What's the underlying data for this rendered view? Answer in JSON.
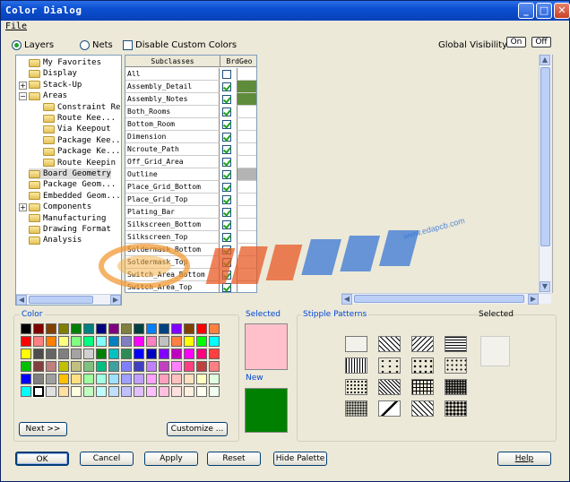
{
  "window": {
    "title": "Color Dialog",
    "minimize_glyph": "_",
    "maximize_glyph": "□",
    "close_glyph": "✕"
  },
  "menu": {
    "file": "File"
  },
  "options": {
    "layers_label": "Layers",
    "nets_label": "Nets",
    "disable_custom_colors_label": "Disable Custom Colors",
    "global_visibility_label": "Global Visibility:",
    "on_label": "On",
    "off_label": "Off",
    "mode": "Layers"
  },
  "tree": {
    "items": [
      {
        "label": "My Favorites",
        "level": 1
      },
      {
        "label": "Display",
        "level": 1
      },
      {
        "label": "Stack-Up",
        "level": 1,
        "expander": "+"
      },
      {
        "label": "Areas",
        "level": 1,
        "expander": "−",
        "open": true
      },
      {
        "label": "Constraint Re",
        "level": 2
      },
      {
        "label": "Route Kee...",
        "level": 2
      },
      {
        "label": "Via Keepout",
        "level": 2
      },
      {
        "label": "Package Kee..",
        "level": 2
      },
      {
        "label": "Package Ke...",
        "level": 2
      },
      {
        "label": "Route Keepin",
        "level": 2
      },
      {
        "label": "Board Geometry",
        "level": 1,
        "selected": true
      },
      {
        "label": "Package Geom...",
        "level": 1
      },
      {
        "label": "Embedded Geom...",
        "level": 1
      },
      {
        "label": "Components",
        "level": 1,
        "expander": "+"
      },
      {
        "label": "Manufacturing",
        "level": 1
      },
      {
        "label": "Drawing Format",
        "level": 1
      },
      {
        "label": "Analysis",
        "level": 1
      }
    ]
  },
  "grid": {
    "col_subclasses": "Subclasses",
    "col_brdgeo": "BrdGeo",
    "rows": [
      {
        "name": "All",
        "checked": false,
        "color": "#ffffff"
      },
      {
        "name": "Assembly_Detail",
        "checked": true,
        "color": "#5f8c3a"
      },
      {
        "name": "Assembly_Notes",
        "checked": true,
        "color": "#5f8c3a"
      },
      {
        "name": "Both_Rooms",
        "checked": true,
        "color": "#ffffff"
      },
      {
        "name": "Bottom_Room",
        "checked": true,
        "color": "#ffffff"
      },
      {
        "name": "Dimension",
        "checked": true,
        "color": "#ffffff"
      },
      {
        "name": "Ncroute_Path",
        "checked": true,
        "color": "#ffffff"
      },
      {
        "name": "Off_Grid_Area",
        "checked": true,
        "color": "#ffffff"
      },
      {
        "name": "Outline",
        "checked": true,
        "color": "#b4b4b4"
      },
      {
        "name": "Place_Grid_Bottom",
        "checked": true,
        "color": "#ffffff"
      },
      {
        "name": "Place_Grid_Top",
        "checked": true,
        "color": "#ffffff"
      },
      {
        "name": "Plating_Bar",
        "checked": true,
        "color": "#ffffff"
      },
      {
        "name": "Silkscreen_Bottom",
        "checked": true,
        "color": "#ffffff"
      },
      {
        "name": "Silkscreen_Top",
        "checked": true,
        "color": "#ffffff"
      },
      {
        "name": "Soldermask_Bottom",
        "checked": true,
        "color": "#ffffff"
      },
      {
        "name": "Soldermask_Top",
        "checked": true,
        "color": "#ffffff"
      },
      {
        "name": "Switch_Area_Bottom",
        "checked": true,
        "color": "#ffffff"
      },
      {
        "name": "Switch_Area_Top",
        "checked": true,
        "color": "#ffffff"
      }
    ]
  },
  "watermark": {
    "text": "eda pcb",
    "url": "www.edapcb.com"
  },
  "color_group": {
    "label": "Color",
    "swatches": [
      [
        "#000000",
        "#800000",
        "#804000",
        "#808000",
        "#008000",
        "#008080",
        "#000080",
        "#800080",
        "#808040",
        "#004040",
        "#0080ff",
        "#004080",
        "#8000ff",
        "#804000",
        "#ff0000",
        "#ff8040"
      ],
      [
        "#ff0000",
        "#ff8080",
        "#ff8000",
        "#ffff80",
        "#80ff80",
        "#00ff80",
        "#80ffff",
        "#0080c0",
        "#8080c0",
        "#ff00ff",
        "#ff80c0",
        "#c0c0c0",
        "#ff8040",
        "#ffff00",
        "#00ff00",
        "#00ffff"
      ],
      [
        "#ffff00",
        "#4d4d4d",
        "#666666",
        "#808080",
        "#a3a3a3",
        "#d0d0d0",
        "#008000",
        "#00c0c0",
        "#2e8b57",
        "#0000ff",
        "#0000c0",
        "#8000ff",
        "#c000c0",
        "#ff00ff",
        "#ff0080",
        "#ff4040"
      ],
      [
        "#00c000",
        "#804040",
        "#c08080",
        "#c0c000",
        "#c0c080",
        "#80c080",
        "#00c080",
        "#40a0a0",
        "#8080ff",
        "#4040c0",
        "#c080ff",
        "#c040c0",
        "#ff80ff",
        "#ff4080",
        "#c04040",
        "#ff8080"
      ],
      [
        "#0000ff",
        "#808080",
        "#a0a0a0",
        "#ffc000",
        "#ffe080",
        "#a0ffa0",
        "#a0ffe0",
        "#a0e0ff",
        "#a0a0ff",
        "#c0a0ff",
        "#ffa0ff",
        "#ffa0c0",
        "#ffc0c0",
        "#ffe0c0",
        "#ffffc0",
        "#e0ffe0"
      ],
      [
        "#00ffff",
        "#ffffff",
        "#e0e0e0",
        "#ffe0a0",
        "#ffffe0",
        "#c0ffc0",
        "#c0ffff",
        "#c0e0ff",
        "#c0c0ff",
        "#e0c0ff",
        "#ffc0ff",
        "#ffc0e0",
        "#ffe0e0",
        "#fff0e0",
        "#fffff0",
        "#f0fff0"
      ]
    ],
    "next_label": "Next >>",
    "customize_label": "Customize ..."
  },
  "selected_label": "Selected",
  "selected_color": "#ffc0cb",
  "new_label": "New",
  "new_color": "#008000",
  "stipple_group": {
    "label": "Stipple Patterns",
    "selected_label": "Selected"
  },
  "buttons": {
    "ok": "OK",
    "cancel": "Cancel",
    "apply": "Apply",
    "reset": "Reset",
    "hide_palette": "Hide Palette",
    "help": "Help"
  }
}
